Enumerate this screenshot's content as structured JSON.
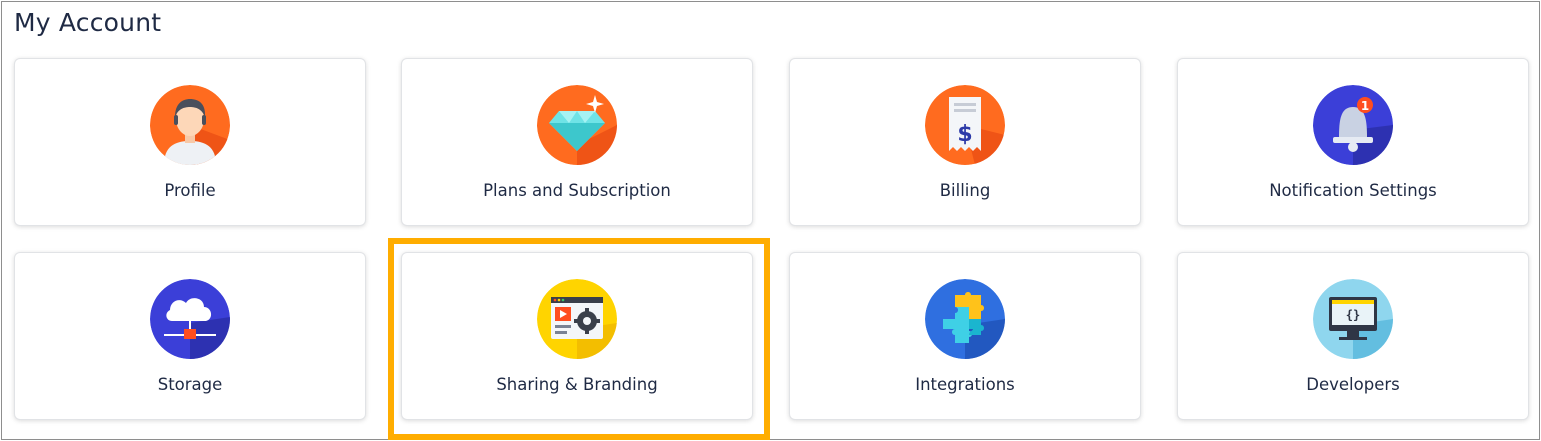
{
  "page": {
    "title": "My Account"
  },
  "colors": {
    "highlight": "#ffad00",
    "text": "#1f2a44"
  },
  "cards": [
    {
      "label": "Profile",
      "icon": "profile-icon"
    },
    {
      "label": "Plans and Subscription",
      "icon": "diamond-icon"
    },
    {
      "label": "Billing",
      "icon": "receipt-icon"
    },
    {
      "label": "Notification Settings",
      "icon": "bell-icon",
      "badge": "1"
    },
    {
      "label": "Storage",
      "icon": "cloud-storage-icon"
    },
    {
      "label": "Sharing & Branding",
      "icon": "media-settings-icon",
      "highlighted": true
    },
    {
      "label": "Integrations",
      "icon": "puzzle-icon"
    },
    {
      "label": "Developers",
      "icon": "code-monitor-icon"
    }
  ]
}
